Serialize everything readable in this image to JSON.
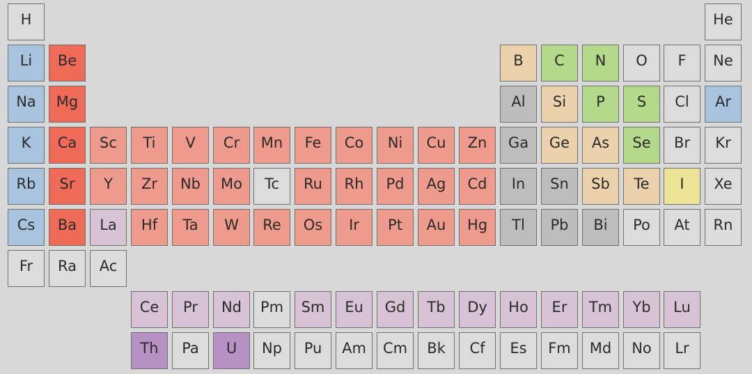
{
  "colors": {
    "alkali": "#a8c3dd",
    "alkaline_earth": "#f06a58",
    "transition": "#ee9a8c",
    "post_transition": "#bdbdbd",
    "metalloid": "#ecd1ad",
    "nonmetal": "#b4d98b",
    "halogen": "#ede497",
    "default": "#dcdcdc",
    "lanthanide_actinide": "#d8c2d6",
    "highlight": "#b791c3"
  },
  "elements": [
    {
      "symbol": "H",
      "row": 0,
      "col": 0,
      "category": "default"
    },
    {
      "symbol": "He",
      "row": 0,
      "col": 17,
      "category": "default"
    },
    {
      "symbol": "Li",
      "row": 1,
      "col": 0,
      "category": "alkali"
    },
    {
      "symbol": "Be",
      "row": 1,
      "col": 1,
      "category": "alkaline_earth"
    },
    {
      "symbol": "B",
      "row": 1,
      "col": 12,
      "category": "metalloid"
    },
    {
      "symbol": "C",
      "row": 1,
      "col": 13,
      "category": "nonmetal"
    },
    {
      "symbol": "N",
      "row": 1,
      "col": 14,
      "category": "nonmetal"
    },
    {
      "symbol": "O",
      "row": 1,
      "col": 15,
      "category": "default"
    },
    {
      "symbol": "F",
      "row": 1,
      "col": 16,
      "category": "default"
    },
    {
      "symbol": "Ne",
      "row": 1,
      "col": 17,
      "category": "default"
    },
    {
      "symbol": "Na",
      "row": 2,
      "col": 0,
      "category": "alkali"
    },
    {
      "symbol": "Mg",
      "row": 2,
      "col": 1,
      "category": "alkaline_earth"
    },
    {
      "symbol": "Al",
      "row": 2,
      "col": 12,
      "category": "post_transition"
    },
    {
      "symbol": "Si",
      "row": 2,
      "col": 13,
      "category": "metalloid"
    },
    {
      "symbol": "P",
      "row": 2,
      "col": 14,
      "category": "nonmetal"
    },
    {
      "symbol": "S",
      "row": 2,
      "col": 15,
      "category": "nonmetal"
    },
    {
      "symbol": "Cl",
      "row": 2,
      "col": 16,
      "category": "default"
    },
    {
      "symbol": "Ar",
      "row": 2,
      "col": 17,
      "category": "alkali"
    },
    {
      "symbol": "K",
      "row": 3,
      "col": 0,
      "category": "alkali"
    },
    {
      "symbol": "Ca",
      "row": 3,
      "col": 1,
      "category": "alkaline_earth"
    },
    {
      "symbol": "Sc",
      "row": 3,
      "col": 2,
      "category": "transition"
    },
    {
      "symbol": "Ti",
      "row": 3,
      "col": 3,
      "category": "transition"
    },
    {
      "symbol": "V",
      "row": 3,
      "col": 4,
      "category": "transition"
    },
    {
      "symbol": "Cr",
      "row": 3,
      "col": 5,
      "category": "transition"
    },
    {
      "symbol": "Mn",
      "row": 3,
      "col": 6,
      "category": "transition"
    },
    {
      "symbol": "Fe",
      "row": 3,
      "col": 7,
      "category": "transition"
    },
    {
      "symbol": "Co",
      "row": 3,
      "col": 8,
      "category": "transition"
    },
    {
      "symbol": "Ni",
      "row": 3,
      "col": 9,
      "category": "transition"
    },
    {
      "symbol": "Cu",
      "row": 3,
      "col": 10,
      "category": "transition"
    },
    {
      "symbol": "Zn",
      "row": 3,
      "col": 11,
      "category": "transition"
    },
    {
      "symbol": "Ga",
      "row": 3,
      "col": 12,
      "category": "post_transition"
    },
    {
      "symbol": "Ge",
      "row": 3,
      "col": 13,
      "category": "metalloid"
    },
    {
      "symbol": "As",
      "row": 3,
      "col": 14,
      "category": "metalloid"
    },
    {
      "symbol": "Se",
      "row": 3,
      "col": 15,
      "category": "nonmetal"
    },
    {
      "symbol": "Br",
      "row": 3,
      "col": 16,
      "category": "default"
    },
    {
      "symbol": "Kr",
      "row": 3,
      "col": 17,
      "category": "default"
    },
    {
      "symbol": "Rb",
      "row": 4,
      "col": 0,
      "category": "alkali"
    },
    {
      "symbol": "Sr",
      "row": 4,
      "col": 1,
      "category": "alkaline_earth"
    },
    {
      "symbol": "Y",
      "row": 4,
      "col": 2,
      "category": "transition"
    },
    {
      "symbol": "Zr",
      "row": 4,
      "col": 3,
      "category": "transition"
    },
    {
      "symbol": "Nb",
      "row": 4,
      "col": 4,
      "category": "transition"
    },
    {
      "symbol": "Mo",
      "row": 4,
      "col": 5,
      "category": "transition"
    },
    {
      "symbol": "Tc",
      "row": 4,
      "col": 6,
      "category": "default"
    },
    {
      "symbol": "Ru",
      "row": 4,
      "col": 7,
      "category": "transition"
    },
    {
      "symbol": "Rh",
      "row": 4,
      "col": 8,
      "category": "transition"
    },
    {
      "symbol": "Pd",
      "row": 4,
      "col": 9,
      "category": "transition"
    },
    {
      "symbol": "Ag",
      "row": 4,
      "col": 10,
      "category": "transition"
    },
    {
      "symbol": "Cd",
      "row": 4,
      "col": 11,
      "category": "transition"
    },
    {
      "symbol": "In",
      "row": 4,
      "col": 12,
      "category": "post_transition"
    },
    {
      "symbol": "Sn",
      "row": 4,
      "col": 13,
      "category": "post_transition"
    },
    {
      "symbol": "Sb",
      "row": 4,
      "col": 14,
      "category": "metalloid"
    },
    {
      "symbol": "Te",
      "row": 4,
      "col": 15,
      "category": "metalloid"
    },
    {
      "symbol": "I",
      "row": 4,
      "col": 16,
      "category": "halogen"
    },
    {
      "symbol": "Xe",
      "row": 4,
      "col": 17,
      "category": "default"
    },
    {
      "symbol": "Cs",
      "row": 5,
      "col": 0,
      "category": "alkali"
    },
    {
      "symbol": "Ba",
      "row": 5,
      "col": 1,
      "category": "alkaline_earth"
    },
    {
      "symbol": "La",
      "row": 5,
      "col": 2,
      "category": "lanthanide_actinide"
    },
    {
      "symbol": "Hf",
      "row": 5,
      "col": 3,
      "category": "transition"
    },
    {
      "symbol": "Ta",
      "row": 5,
      "col": 4,
      "category": "transition"
    },
    {
      "symbol": "W",
      "row": 5,
      "col": 5,
      "category": "transition"
    },
    {
      "symbol": "Re",
      "row": 5,
      "col": 6,
      "category": "transition"
    },
    {
      "symbol": "Os",
      "row": 5,
      "col": 7,
      "category": "transition"
    },
    {
      "symbol": "Ir",
      "row": 5,
      "col": 8,
      "category": "transition"
    },
    {
      "symbol": "Pt",
      "row": 5,
      "col": 9,
      "category": "transition"
    },
    {
      "symbol": "Au",
      "row": 5,
      "col": 10,
      "category": "transition"
    },
    {
      "symbol": "Hg",
      "row": 5,
      "col": 11,
      "category": "transition"
    },
    {
      "symbol": "Tl",
      "row": 5,
      "col": 12,
      "category": "post_transition"
    },
    {
      "symbol": "Pb",
      "row": 5,
      "col": 13,
      "category": "post_transition"
    },
    {
      "symbol": "Bi",
      "row": 5,
      "col": 14,
      "category": "post_transition"
    },
    {
      "symbol": "Po",
      "row": 5,
      "col": 15,
      "category": "default"
    },
    {
      "symbol": "At",
      "row": 5,
      "col": 16,
      "category": "default"
    },
    {
      "symbol": "Rn",
      "row": 5,
      "col": 17,
      "category": "default"
    },
    {
      "symbol": "Fr",
      "row": 6,
      "col": 0,
      "category": "default"
    },
    {
      "symbol": "Ra",
      "row": 6,
      "col": 1,
      "category": "default"
    },
    {
      "symbol": "Ac",
      "row": 6,
      "col": 2,
      "category": "default"
    },
    {
      "symbol": "Ce",
      "row": 7,
      "col": 3,
      "category": "lanthanide_actinide"
    },
    {
      "symbol": "Pr",
      "row": 7,
      "col": 4,
      "category": "lanthanide_actinide"
    },
    {
      "symbol": "Nd",
      "row": 7,
      "col": 5,
      "category": "lanthanide_actinide"
    },
    {
      "symbol": "Pm",
      "row": 7,
      "col": 6,
      "category": "default"
    },
    {
      "symbol": "Sm",
      "row": 7,
      "col": 7,
      "category": "lanthanide_actinide"
    },
    {
      "symbol": "Eu",
      "row": 7,
      "col": 8,
      "category": "lanthanide_actinide"
    },
    {
      "symbol": "Gd",
      "row": 7,
      "col": 9,
      "category": "lanthanide_actinide"
    },
    {
      "symbol": "Tb",
      "row": 7,
      "col": 10,
      "category": "lanthanide_actinide"
    },
    {
      "symbol": "Dy",
      "row": 7,
      "col": 11,
      "category": "lanthanide_actinide"
    },
    {
      "symbol": "Ho",
      "row": 7,
      "col": 12,
      "category": "lanthanide_actinide"
    },
    {
      "symbol": "Er",
      "row": 7,
      "col": 13,
      "category": "lanthanide_actinide"
    },
    {
      "symbol": "Tm",
      "row": 7,
      "col": 14,
      "category": "lanthanide_actinide"
    },
    {
      "symbol": "Yb",
      "row": 7,
      "col": 15,
      "category": "lanthanide_actinide"
    },
    {
      "symbol": "Lu",
      "row": 7,
      "col": 16,
      "category": "lanthanide_actinide"
    },
    {
      "symbol": "Th",
      "row": 8,
      "col": 3,
      "category": "highlight"
    },
    {
      "symbol": "Pa",
      "row": 8,
      "col": 4,
      "category": "default"
    },
    {
      "symbol": "U",
      "row": 8,
      "col": 5,
      "category": "highlight"
    },
    {
      "symbol": "Np",
      "row": 8,
      "col": 6,
      "category": "default"
    },
    {
      "symbol": "Pu",
      "row": 8,
      "col": 7,
      "category": "default"
    },
    {
      "symbol": "Am",
      "row": 8,
      "col": 8,
      "category": "default"
    },
    {
      "symbol": "Cm",
      "row": 8,
      "col": 9,
      "category": "default"
    },
    {
      "symbol": "Bk",
      "row": 8,
      "col": 10,
      "category": "default"
    },
    {
      "symbol": "Cf",
      "row": 8,
      "col": 11,
      "category": "default"
    },
    {
      "symbol": "Es",
      "row": 8,
      "col": 12,
      "category": "default"
    },
    {
      "symbol": "Fm",
      "row": 8,
      "col": 13,
      "category": "default"
    },
    {
      "symbol": "Md",
      "row": 8,
      "col": 14,
      "category": "default"
    },
    {
      "symbol": "No",
      "row": 8,
      "col": 15,
      "category": "default"
    },
    {
      "symbol": "Lr",
      "row": 8,
      "col": 16,
      "category": "default"
    }
  ]
}
